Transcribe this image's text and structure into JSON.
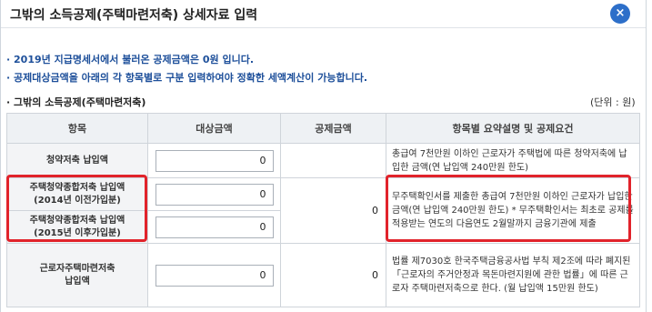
{
  "dialog": {
    "title": "그밖의 소득공제(주택마련저축) 상세자료 입력",
    "close_symbol": "×"
  },
  "notices": [
    "· 2019년 지급명세서에서 불러온 공제금액은 0원 입니다.",
    "· 공제대상금액을 아래의 각 항목별로 구분 입력하여야 정확한 세액계산이 가능합니다."
  ],
  "section": {
    "title": "· 그밖의 소득공제(주택마련저축)",
    "unit": "(단위 : 원)"
  },
  "table": {
    "headers": [
      "항목",
      "대상금액",
      "공제금액",
      "항목별 요약설명 및 공제요건"
    ],
    "rows": [
      {
        "label_line1": "청약저축 납입액",
        "label_line2": "",
        "target": "0",
        "deduction": "",
        "desc": "총급여 7천만원 이하인 근로자가 주택법에 따른 청약저축에 납입한 금액(연 납입액 240만원 한도)"
      },
      {
        "label_line1": "주택청약종합저축 납입액",
        "label_line2": "(2014년 이전가입분)",
        "target": "0",
        "deduction": "0",
        "desc": "무주택확인서를 제출한 총급여 7천만원 이하인 근로자가 납입한 금액(연 납입액 240만원 한도) * 무주택확인서는 최초로 공제를 적용받는 연도의 다음연도 2월말까지 금융기관에 제출"
      },
      {
        "label_line1": "주택청약종합저축 납입액",
        "label_line2": "(2015년 이후가입분)",
        "target": "0",
        "deduction": "",
        "desc": ""
      },
      {
        "label_line1": "근로자주택마련저축",
        "label_line2": "납입액",
        "target": "0",
        "deduction": "0",
        "desc": "법률 제7030호 한국주택금융공사법 부칙 제2조에 따라 폐지된 「근로자의 주거안정과 목돈마련지원에 관한 법률」에 따른 근로자 주택마련저축으로 한다. (월 납입액 15만원 한도)"
      }
    ]
  },
  "colors": {
    "accent": "#2d6fc9",
    "highlight": "#e1232b",
    "notice_text": "#1d4f9a"
  }
}
